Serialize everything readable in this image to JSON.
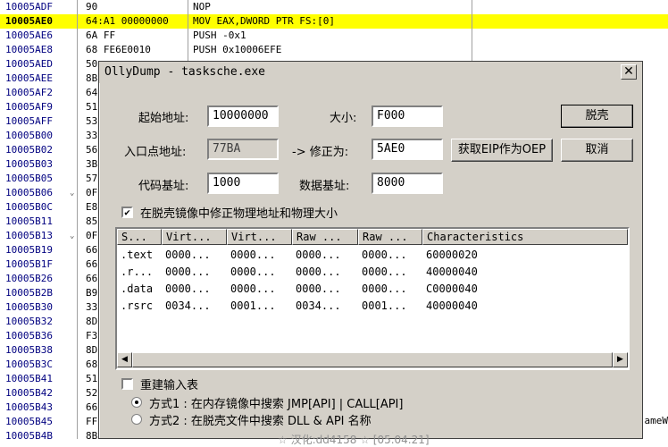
{
  "disassembly": {
    "rows": [
      {
        "addr": "10005ADF",
        "hex": "90",
        "cmd": "NOP",
        "hl": false,
        "arrow": ""
      },
      {
        "addr": "10005AE0",
        "hex": "64:A1 00000000",
        "cmd": "MOV EAX,DWORD PTR FS:[0]",
        "hl": true,
        "arrow": ""
      },
      {
        "addr": "10005AE6",
        "hex": "6A FF",
        "cmd": "PUSH -0x1",
        "hl": false,
        "arrow": ""
      },
      {
        "addr": "10005AE8",
        "hex": "68 FE6E0010",
        "cmd": "PUSH 0x10006EFE",
        "hl": false,
        "arrow": ""
      },
      {
        "addr": "10005AED",
        "hex": "50",
        "cmd": "",
        "hl": false,
        "arrow": ""
      },
      {
        "addr": "10005AEE",
        "hex": "8B",
        "cmd": "",
        "hl": false,
        "arrow": ""
      },
      {
        "addr": "10005AF2",
        "hex": "64",
        "cmd": "",
        "hl": false,
        "arrow": ""
      },
      {
        "addr": "10005AF9",
        "hex": "51",
        "cmd": "",
        "hl": false,
        "arrow": ""
      },
      {
        "addr": "10005AFF",
        "hex": "53",
        "cmd": "",
        "hl": false,
        "arrow": ""
      },
      {
        "addr": "10005B00",
        "hex": "33",
        "cmd": "",
        "hl": false,
        "arrow": ""
      },
      {
        "addr": "10005B02",
        "hex": "56",
        "cmd": "",
        "hl": false,
        "arrow": ""
      },
      {
        "addr": "10005B03",
        "hex": "3B",
        "cmd": "",
        "hl": false,
        "arrow": ""
      },
      {
        "addr": "10005B05",
        "hex": "57",
        "cmd": "",
        "hl": false,
        "arrow": ""
      },
      {
        "addr": "10005B06",
        "hex": "0F",
        "cmd": "",
        "hl": false,
        "arrow": "⌄"
      },
      {
        "addr": "10005B0C",
        "hex": "E8",
        "cmd": "",
        "hl": false,
        "arrow": ""
      },
      {
        "addr": "10005B11",
        "hex": "85",
        "cmd": "",
        "hl": false,
        "arrow": ""
      },
      {
        "addr": "10005B13",
        "hex": "0F",
        "cmd": "",
        "hl": false,
        "arrow": "⌄"
      },
      {
        "addr": "10005B19",
        "hex": "66",
        "cmd": "",
        "hl": false,
        "arrow": ""
      },
      {
        "addr": "10005B1F",
        "hex": "66",
        "cmd": "",
        "hl": false,
        "arrow": ""
      },
      {
        "addr": "10005B26",
        "hex": "66",
        "cmd": "",
        "hl": false,
        "arrow": ""
      },
      {
        "addr": "10005B2B",
        "hex": "B9",
        "cmd": "",
        "hl": false,
        "arrow": ""
      },
      {
        "addr": "10005B30",
        "hex": "33",
        "cmd": "",
        "hl": false,
        "arrow": ""
      },
      {
        "addr": "10005B32",
        "hex": "8D",
        "cmd": "",
        "hl": false,
        "arrow": ""
      },
      {
        "addr": "10005B36",
        "hex": "F3",
        "cmd": "",
        "hl": false,
        "arrow": ""
      },
      {
        "addr": "10005B38",
        "hex": "8D",
        "cmd": "",
        "hl": false,
        "arrow": ""
      },
      {
        "addr": "10005B3C",
        "hex": "68",
        "cmd": "",
        "hl": false,
        "arrow": ""
      },
      {
        "addr": "10005B41",
        "hex": "51",
        "cmd": "",
        "hl": false,
        "arrow": ""
      },
      {
        "addr": "10005B42",
        "hex": "52",
        "cmd": "",
        "hl": false,
        "arrow": ""
      },
      {
        "addr": "10005B43",
        "hex": "66",
        "cmd": "",
        "hl": false,
        "arrow": ""
      },
      {
        "addr": "10005B45",
        "hex": "FF",
        "cmd": "",
        "hl": false,
        "arrow": ""
      },
      {
        "addr": "10005B4B",
        "hex": "8B",
        "cmd": "",
        "hl": false,
        "arrow": ""
      }
    ],
    "tail_text": "ameW"
  },
  "dialog": {
    "title": "OllyDump - tasksche.exe",
    "close_glyph": "✕",
    "start_addr_label": "起始地址:",
    "start_addr_value": "10000000",
    "size_label": "大小:",
    "size_value": "F000",
    "entry_label": "入口点地址:",
    "entry_value": "77BA",
    "fix_label": "-> 修正为:",
    "fix_value": "5AE0",
    "code_base_label": "代码基址:",
    "code_base_value": "1000",
    "data_base_label": "数据基址:",
    "data_base_value": "8000",
    "dump_button": "脱壳",
    "get_eip_button": "获取EIP作为OEP",
    "cancel_button": "取消",
    "fix_phys_checkbox_label": "在脱壳镜像中修正物理地址和物理大小",
    "fix_phys_checked": true,
    "sections": {
      "columns": [
        "S...",
        "Virt...",
        "Virt...",
        "Raw ...",
        "Raw ...",
        "Characteristics"
      ],
      "rows": [
        [
          ".text",
          "0000...",
          "0000...",
          "0000...",
          "0000...",
          "60000020"
        ],
        [
          ".r...",
          "0000...",
          "0000...",
          "0000...",
          "0000...",
          "40000040"
        ],
        [
          ".data",
          "0000...",
          "0000...",
          "0000...",
          "0000...",
          "C0000040"
        ],
        [
          ".rsrc",
          "0034...",
          "0001...",
          "0034...",
          "0001...",
          "40000040"
        ]
      ]
    },
    "rebuild_label": "重建输入表",
    "rebuild_checked": false,
    "method1_label": "方式1 : 在内存镜像中搜索 JMP[API] | CALL[API]",
    "method2_label": "方式2 : 在脱壳文件中搜索 DLL & API 名称",
    "selected_method": 1,
    "footer_text": "☆ 汉化:dd4158 ☆ [05.04.21]"
  }
}
